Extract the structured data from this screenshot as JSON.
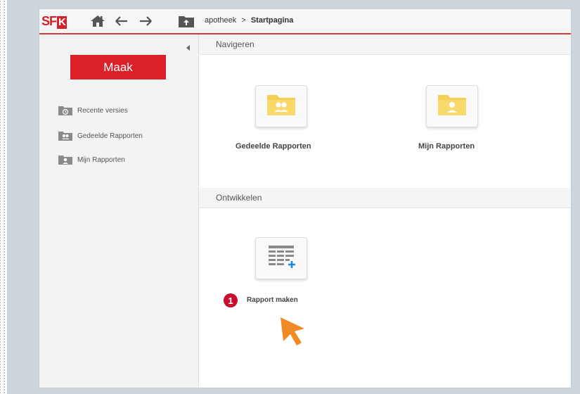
{
  "app": {
    "logo_text": "SF",
    "logo_k": "K"
  },
  "toolbar": {
    "icons": [
      "home-icon",
      "back-arrow-icon",
      "forward-arrow-icon",
      "folder-up-icon"
    ]
  },
  "breadcrumb": {
    "root": "apotheek",
    "separator": ">",
    "current": "Startpagina"
  },
  "sidebar": {
    "create_button": "Maak",
    "items": [
      {
        "label": "Recente versies",
        "icon": "recent-folder-icon"
      },
      {
        "label": "Gedeelde Rapporten",
        "icon": "shared-folder-icon"
      },
      {
        "label": "Mijn Rapporten",
        "icon": "user-folder-icon"
      }
    ]
  },
  "main": {
    "navigate": {
      "heading": "Navigeren",
      "tiles": [
        {
          "label": "Gedeelde Rapporten",
          "icon": "shared-folder-icon"
        },
        {
          "label": "Mijn Rapporten",
          "icon": "user-folder-icon"
        }
      ]
    },
    "develop": {
      "heading": "Ontwikkelen",
      "tiles": [
        {
          "label": "Rapport maken",
          "icon": "report-add-icon",
          "step": "1"
        }
      ]
    }
  },
  "colors": {
    "brand_red": "#dc2028",
    "folder_yellow": "#f5cf55",
    "cursor_orange": "#f08a24",
    "badge_red": "#c8102e"
  }
}
